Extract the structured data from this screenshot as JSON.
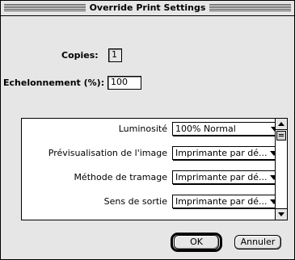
{
  "dialog": {
    "title": "Override Print Settings"
  },
  "copies": {
    "label": "Copies:",
    "value": "1"
  },
  "scaling": {
    "label": "Echelonnement (%):",
    "value": "100"
  },
  "settings": [
    {
      "label": "Luminosité",
      "value": "100% Normal"
    },
    {
      "label": "Prévisualisation de l'image",
      "value": "Imprimante par dé..."
    },
    {
      "label": "Méthode de tramage",
      "value": "Imprimante par dé..."
    },
    {
      "label": "Sens de sortie",
      "value": "Imprimante par dé..."
    }
  ],
  "buttons": {
    "ok": "OK",
    "cancel": "Annuler"
  }
}
